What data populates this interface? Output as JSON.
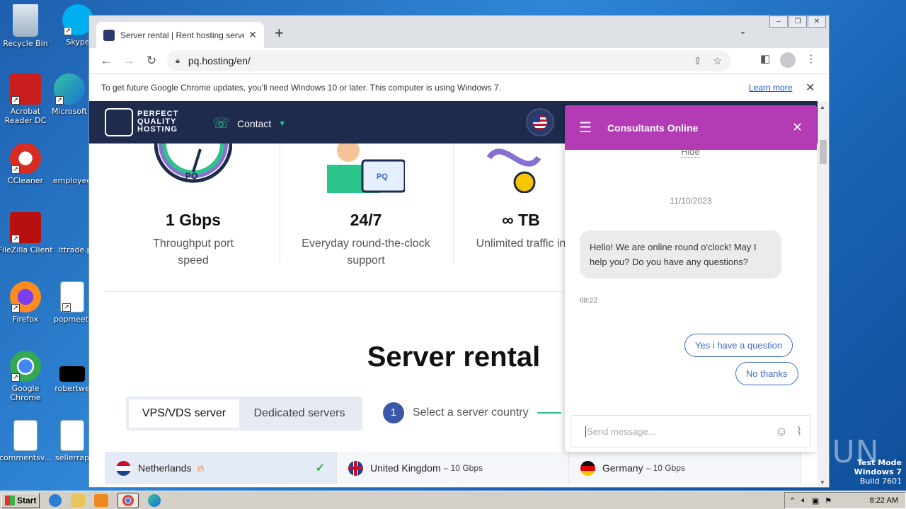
{
  "desktop": {
    "icons": [
      {
        "label": "Recycle Bin"
      },
      {
        "label": "Skype"
      },
      {
        "label": "Acrobat Reader DC"
      },
      {
        "label": "Microsoft"
      },
      {
        "label": "CCleaner"
      },
      {
        "label": "employee"
      },
      {
        "label": "FileZilla Client"
      },
      {
        "label": "ittrade.p"
      },
      {
        "label": "Firefox"
      },
      {
        "label": "popmeeti"
      },
      {
        "label": "Google Chrome"
      },
      {
        "label": "robertwe"
      },
      {
        "label": "commentsv..."
      },
      {
        "label": "sellerrap"
      }
    ],
    "watermark": "ANY RUN",
    "testmode": {
      "line1": "Test Mode",
      "line2": "Windows 7",
      "line3": "Build 7601"
    }
  },
  "browser": {
    "tab_title": "Server rental | Rent hosting servers",
    "url": "pq.hosting/en/",
    "infobar_text": "To get future Google Chrome updates, you'll need Windows 10 or later. This computer is using Windows 7.",
    "infobar_link": "Learn more"
  },
  "site": {
    "logo_lines": [
      "PERFECT",
      "QUALITY",
      "HOSTING"
    ],
    "contact": "Contact",
    "features": [
      {
        "big": "1 Gbps",
        "sub": "Throughput port speed"
      },
      {
        "big": "24/7",
        "sub": "Everyday round-the-clock support"
      },
      {
        "big": "∞ TB",
        "sub": "Unlimited traffic in"
      }
    ],
    "heading": "Server rental",
    "tabs": [
      "VPS/VDS server",
      "Dedicated servers"
    ],
    "step_num": "1",
    "step_label": "Select a server country",
    "countries": [
      {
        "name": "Netherlands",
        "speed": ""
      },
      {
        "name": "United Kingdom",
        "speed": "– 10 Gbps"
      },
      {
        "name": "Germany",
        "speed": "– 10 Gbps"
      }
    ]
  },
  "chat": {
    "title": "Consultants Online",
    "hide": "Hide",
    "date": "11/10/2023",
    "message": "Hello! We are online round o'clock! May I help you? Do you have any questions?",
    "time": "08:22",
    "reply_yes": "Yes i have a question",
    "reply_no": "No thanks",
    "input_placeholder": "Send message..."
  },
  "taskbar": {
    "start": "Start",
    "clock": "8:22 AM"
  }
}
